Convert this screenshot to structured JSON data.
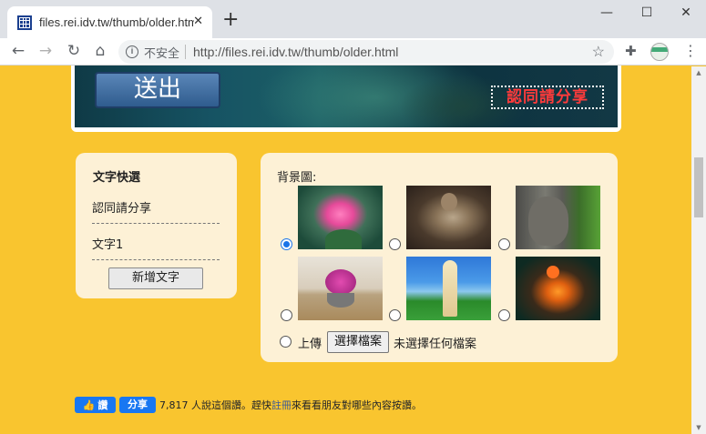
{
  "browser": {
    "tab_title": "files.rei.idv.tw/thumb/older.html",
    "tab_close": "✕",
    "new_tab": "+",
    "window_controls": {
      "minimize": "—",
      "maximize": "☐",
      "close": "✕"
    },
    "nav": {
      "back": "←",
      "forward": "→",
      "reload": "↻",
      "home": "⌂"
    },
    "security_label": "不安全",
    "url": "http://files.rei.idv.tw/thumb/older.html",
    "icons": [
      "info-icon",
      "star-icon",
      "extensions-icon",
      "profile-icon",
      "menu-icon"
    ]
  },
  "banner": {
    "submit_label": "送出",
    "stamp_text": "認同請分享"
  },
  "text_panel": {
    "title": "文字快選",
    "items": [
      "認同請分享",
      "文字1"
    ],
    "add_button": "新增文字"
  },
  "background_panel": {
    "label": "背景圖:",
    "options": [
      {
        "name": "lotus",
        "selected": true
      },
      {
        "name": "buddha-statue",
        "selected": false
      },
      {
        "name": "stone-face",
        "selected": false
      },
      {
        "name": "flower-bowl",
        "selected": false
      },
      {
        "name": "guanyin-statue",
        "selected": false
      },
      {
        "name": "glowing-gourd",
        "selected": false
      }
    ],
    "upload_label": "上傳",
    "choose_file_button": "選擇檔案",
    "no_file_text": "未選擇任何檔案"
  },
  "facebook": {
    "like_label": "讚",
    "share_label": "分享",
    "count_text": "7,817 人說這個讚。趕快",
    "register_link": "註冊",
    "trailing_text": "來看看朋友對哪些內容按讚。"
  }
}
